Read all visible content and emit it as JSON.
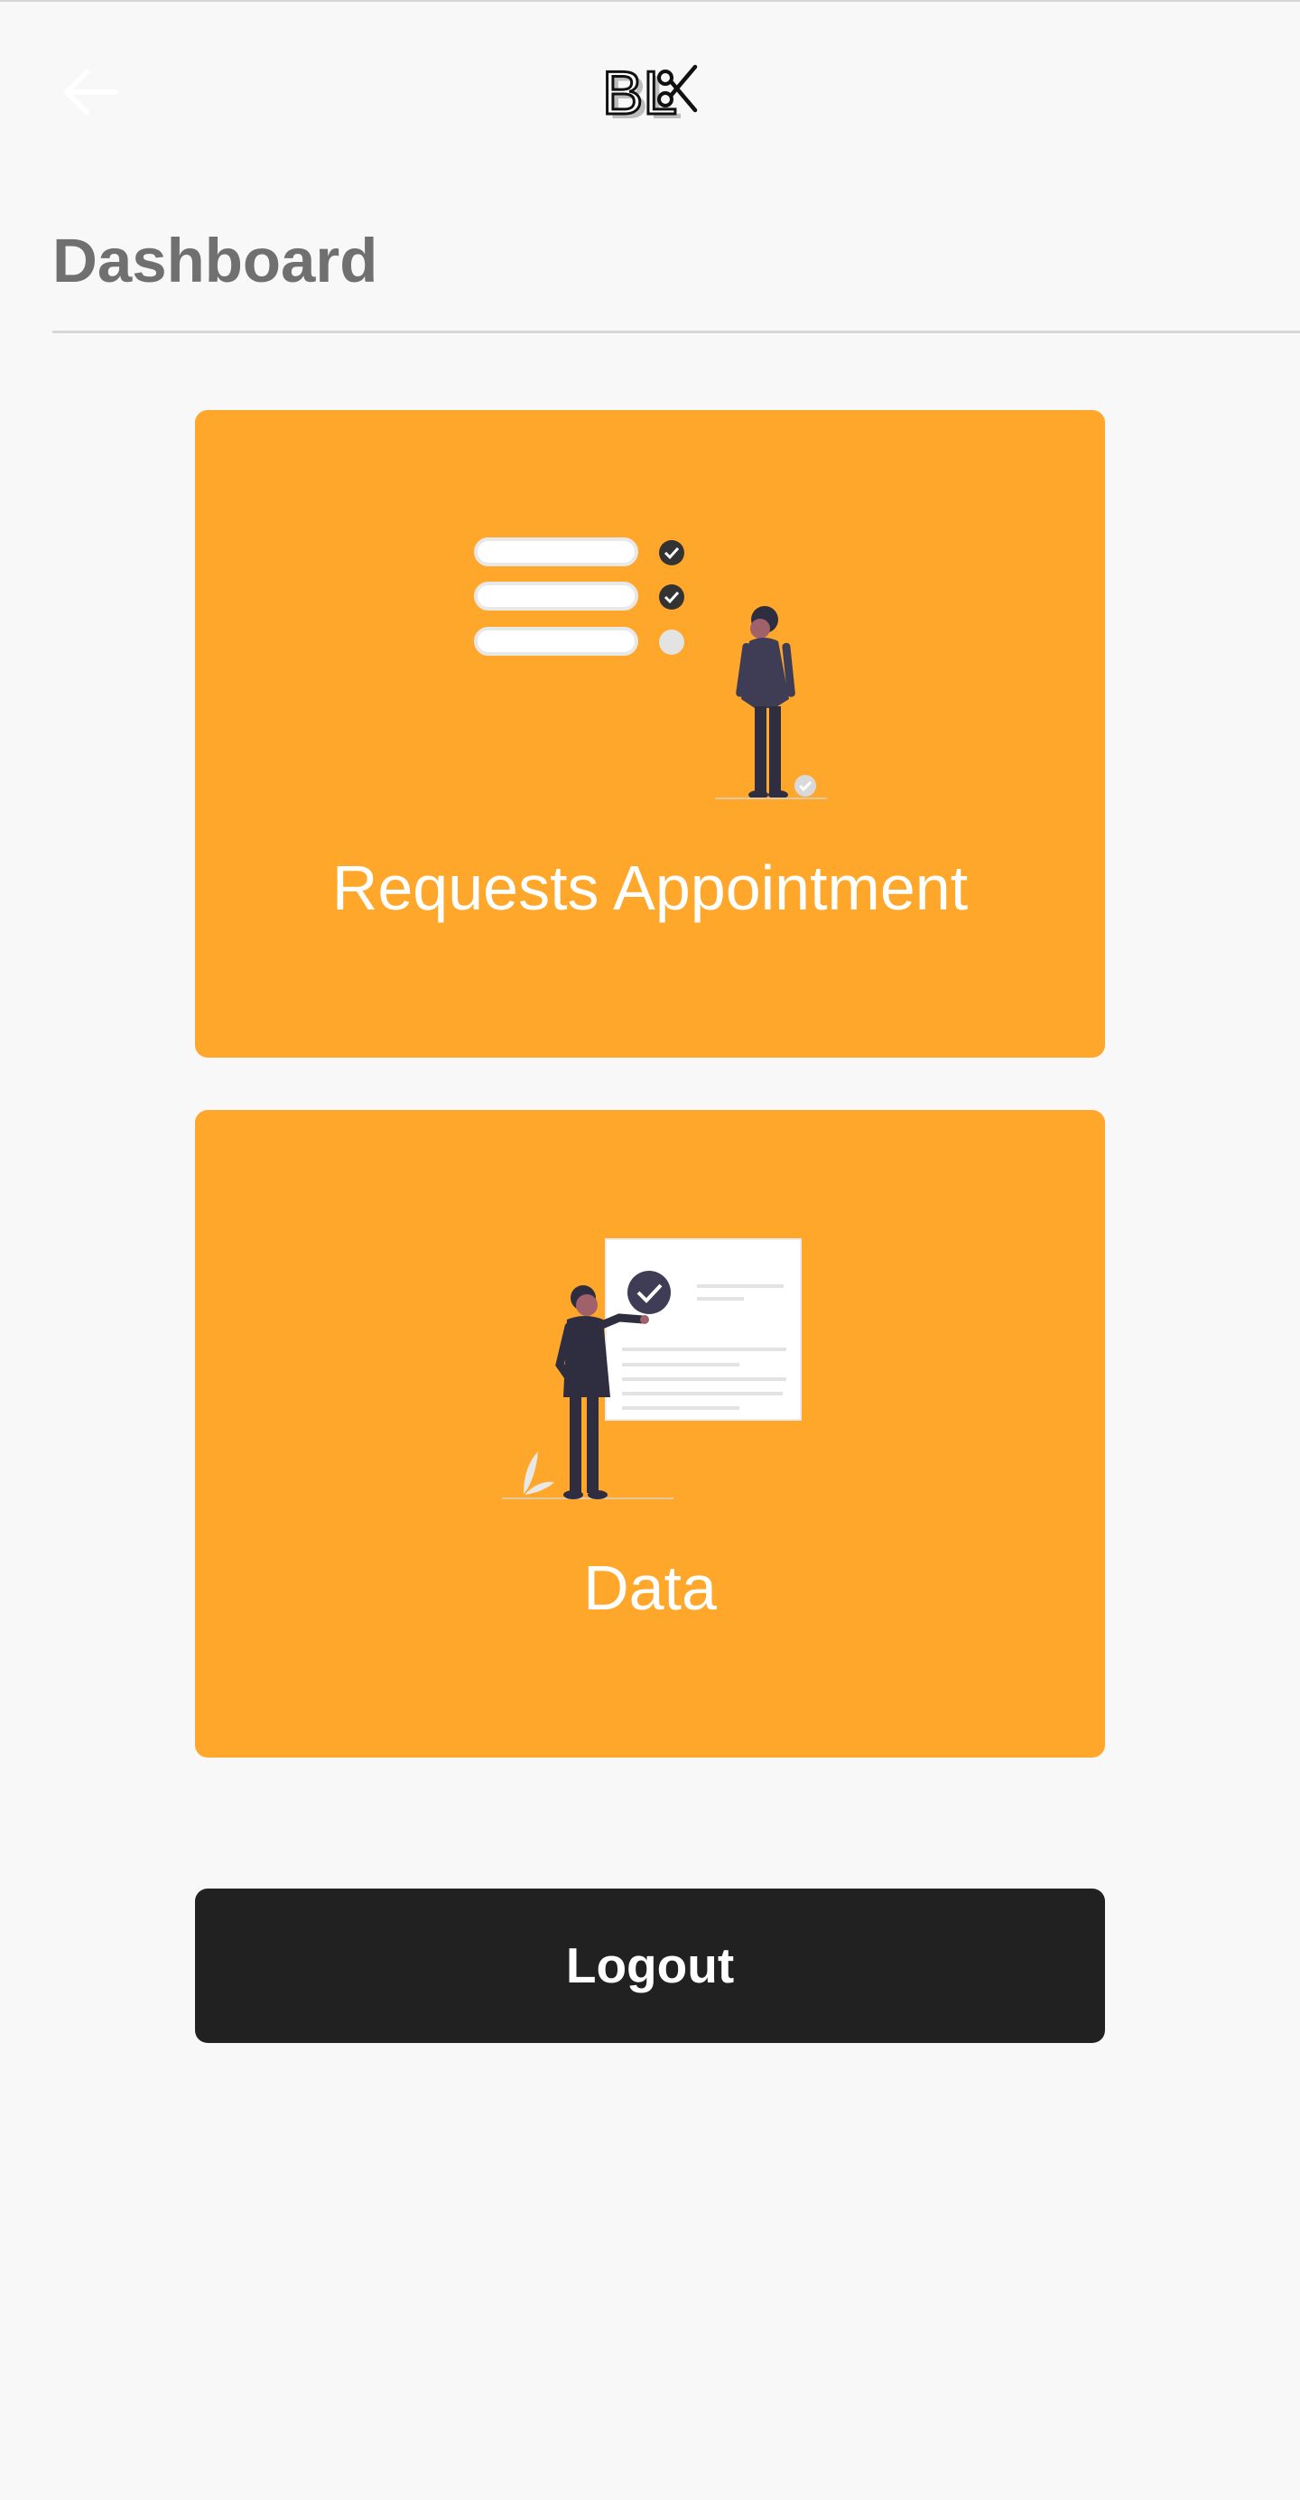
{
  "header": {
    "back_icon": "arrow-left-icon",
    "logo_text": "BL"
  },
  "page": {
    "title": "Dashboard"
  },
  "cards": [
    {
      "label": "Requests Appointment",
      "illustration": "checklist-person"
    },
    {
      "label": "Data",
      "illustration": "document-check-person"
    }
  ],
  "actions": {
    "logout_label": "Logout"
  },
  "colors": {
    "background": "#f8f8f8",
    "card": "#fea72a",
    "button": "#212121",
    "title": "#707070"
  }
}
